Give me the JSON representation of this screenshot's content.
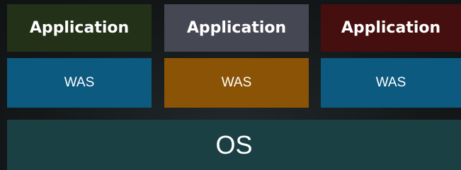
{
  "stack": {
    "applications": [
      {
        "label": "Application",
        "color": "#233119"
      },
      {
        "label": "Application",
        "color": "#454753"
      },
      {
        "label": "Application",
        "color": "#450f0f"
      }
    ],
    "was": [
      {
        "label": "WAS",
        "color": "#0d5a80"
      },
      {
        "label": "WAS",
        "color": "#8b5306"
      },
      {
        "label": "WAS",
        "color": "#0d5a80"
      }
    ],
    "os": {
      "label": "OS",
      "color": "#1b4044"
    }
  }
}
